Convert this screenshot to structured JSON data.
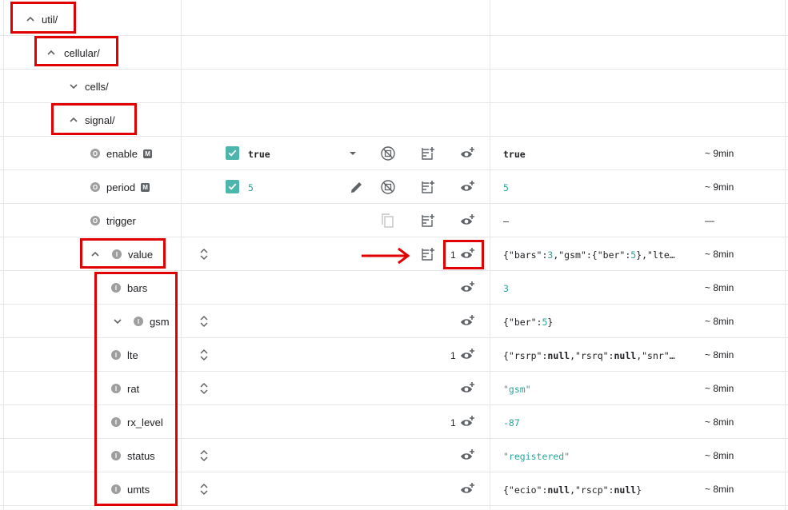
{
  "tree": {
    "util": {
      "label": "util/"
    },
    "cellular": {
      "label": "cellular/"
    },
    "cells": {
      "label": "cells/"
    },
    "signal": {
      "label": "signal/"
    },
    "enable": {
      "label": "enable",
      "type_badge": "O",
      "mode_badge": "M",
      "editor_value": "true",
      "current_value": "true",
      "age": "~ 9min"
    },
    "period": {
      "label": "period",
      "type_badge": "O",
      "mode_badge": "M",
      "editor_value": "5",
      "current_value": "5",
      "age": "~ 9min"
    },
    "trigger": {
      "label": "trigger",
      "type_badge": "O",
      "current_value": "—",
      "age": "—"
    },
    "value": {
      "label": "value",
      "type_badge": "I",
      "observe_count": "1",
      "current_value": "{\"bars\":3,\"gsm\":{\"ber\":5},\"lte…",
      "age": "~ 8min"
    },
    "children": [
      {
        "label": "bars",
        "type_badge": "I",
        "has_sort": false,
        "has_chevron": false,
        "observe_count": "",
        "current_value": "3",
        "value_style": "number",
        "age": "~ 8min"
      },
      {
        "label": "gsm",
        "type_badge": "I",
        "has_sort": true,
        "has_chevron": true,
        "observe_count": "",
        "current_value": "{\"ber\":5}",
        "value_style": "object",
        "age": "~ 8min"
      },
      {
        "label": "lte",
        "type_badge": "I",
        "has_sort": true,
        "has_chevron": false,
        "observe_count": "1",
        "current_value": "{\"rsrp\":null,\"rsrq\":null,\"snr\"…",
        "value_style": "object",
        "age": "~ 8min"
      },
      {
        "label": "rat",
        "type_badge": "I",
        "has_sort": true,
        "has_chevron": false,
        "observe_count": "",
        "current_value": "\"gsm\"",
        "value_style": "string",
        "age": "~ 8min"
      },
      {
        "label": "rx_level",
        "type_badge": "I",
        "has_sort": false,
        "has_chevron": false,
        "observe_count": "1",
        "current_value": "-87",
        "value_style": "number",
        "age": "~ 8min"
      },
      {
        "label": "status",
        "type_badge": "I",
        "has_sort": true,
        "has_chevron": false,
        "observe_count": "",
        "current_value": "\"registered\"",
        "value_style": "string",
        "age": "~ 8min"
      },
      {
        "label": "umts",
        "type_badge": "I",
        "has_sort": true,
        "has_chevron": false,
        "observe_count": "",
        "current_value": "{\"ecio\":null,\"rscp\":null}",
        "value_style": "object",
        "age": "~ 8min"
      }
    ]
  },
  "colors": {
    "accent": "#26a69a",
    "checkbox": "#4db6ac",
    "annotation": "#e00000",
    "icon": "#5f6368",
    "badge": "#9e9e9e"
  },
  "icons": [
    "chevron-up-icon",
    "chevron-down-icon",
    "dropdown-arrow-icon",
    "edit-icon",
    "execute-disabled-icon",
    "copy-icon",
    "add-note-icon",
    "observe-icon",
    "sort-icon",
    "checkbox-checked-icon"
  ]
}
